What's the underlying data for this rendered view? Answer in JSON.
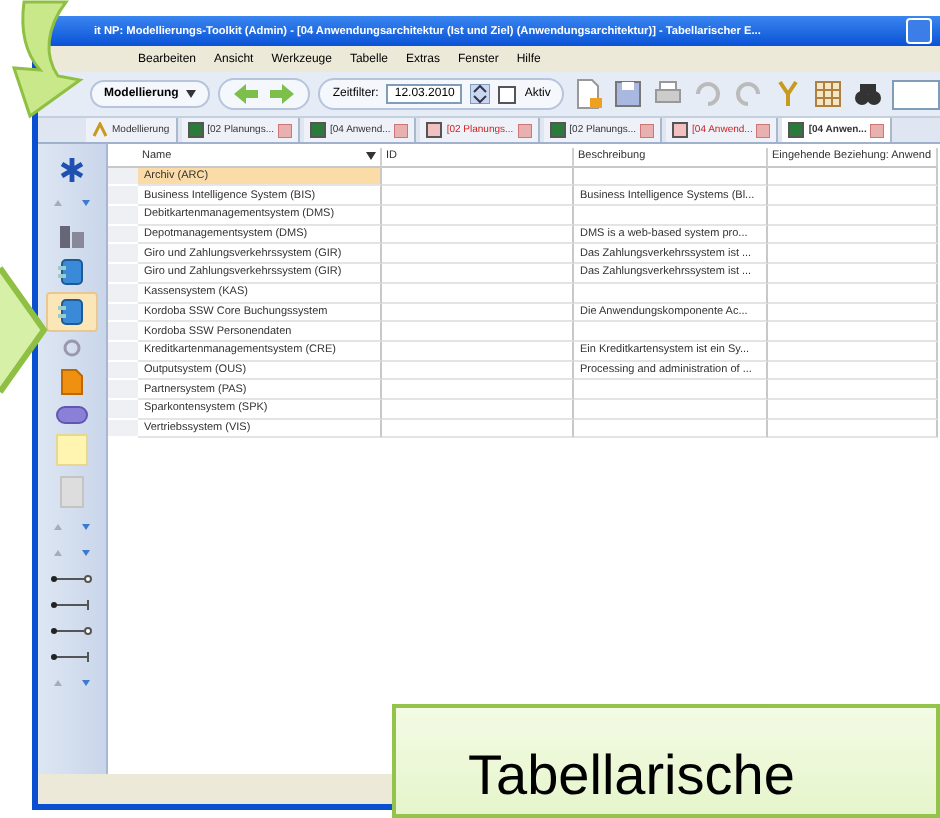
{
  "window": {
    "title": "it NP: Modellierungs-Toolkit (Admin) - [04 Anwendungsarchitektur (Ist und Ziel) (Anwendungsarchitektur)] - Tabellarischer E..."
  },
  "menu": [
    "Bearbeiten",
    "Ansicht",
    "Werkzeuge",
    "Tabelle",
    "Extras",
    "Fenster",
    "Hilfe"
  ],
  "toolbar": {
    "perspective": "Modellierung",
    "time_filter_label": "Zeitfilter:",
    "date": "12.03.2010",
    "active_label": "Aktiv",
    "active_checked": false
  },
  "tabs": [
    {
      "label": "Modellierung",
      "selected": false,
      "flagged": false
    },
    {
      "label": "[02 Planungs...",
      "selected": false,
      "flagged": false
    },
    {
      "label": "[04 Anwend...",
      "selected": false,
      "flagged": false
    },
    {
      "label": "[02 Planungs...",
      "selected": false,
      "flagged": true
    },
    {
      "label": "[02 Planungs...",
      "selected": false,
      "flagged": false
    },
    {
      "label": "[04 Anwend...",
      "selected": false,
      "flagged": true
    },
    {
      "label": "[04 Anwen...",
      "selected": true,
      "flagged": false
    }
  ],
  "palette": [
    {
      "kind": "asterisk",
      "selected": false
    },
    {
      "kind": "nav",
      "selected": false
    },
    {
      "kind": "building",
      "selected": false
    },
    {
      "kind": "component",
      "selected": false
    },
    {
      "kind": "component",
      "selected": true
    },
    {
      "kind": "interface",
      "selected": false
    },
    {
      "kind": "document",
      "selected": false
    },
    {
      "kind": "pill",
      "selected": false
    },
    {
      "kind": "note",
      "selected": false
    },
    {
      "kind": "frame",
      "selected": false
    },
    {
      "kind": "nav",
      "selected": false
    },
    {
      "kind": "nav",
      "selected": false
    },
    {
      "kind": "link-open",
      "selected": false
    },
    {
      "kind": "link-bar",
      "selected": false
    },
    {
      "kind": "link-open",
      "selected": false
    },
    {
      "kind": "link-bar",
      "selected": false
    },
    {
      "kind": "nav",
      "selected": false
    }
  ],
  "table": {
    "columns": [
      "Name",
      "ID",
      "Beschreibung",
      "Eingehende Beziehung: Anwend"
    ],
    "rows": [
      {
        "name": "Archiv (ARC)",
        "selected": true
      },
      {
        "name": "Business Intelligence System (BIS)",
        "description": "Business Intelligence Systems (Bl...",
        "selected": false
      },
      {
        "name": "Debitkartenmanagementsystem (DMS)",
        "selected": false
      },
      {
        "name": "Depotmanagementsystem (DMS)",
        "description": "DMS is a web-based system pro...",
        "selected": false
      },
      {
        "name": "Giro und Zahlungsverkehrssystem (GIR)",
        "description": "Das Zahlungsverkehrssystem ist ...",
        "selected": false
      },
      {
        "name": "Giro und Zahlungsverkehrssystem (GIR)",
        "description": "Das Zahlungsverkehrssystem ist ...",
        "selected": false
      },
      {
        "name": "Kassensystem (KAS)",
        "selected": false
      },
      {
        "name": "Kordoba SSW Core Buchungssystem",
        "description": "Die Anwendungskomponente Ac...",
        "selected": false
      },
      {
        "name": "Kordoba SSW Personendaten",
        "selected": false
      },
      {
        "name": "Kreditkartenmanagementsystem (CRE)",
        "description": "Ein Kreditkartensystem ist ein Sy...",
        "selected": false
      },
      {
        "name": "Outputsystem (OUS)",
        "description": "Processing and administration of ...",
        "selected": false
      },
      {
        "name": "Partnersystem (PAS)",
        "selected": false
      },
      {
        "name": "Sparkontensystem (SPK)",
        "selected": false
      },
      {
        "name": "Vertriebssystem (VIS)",
        "selected": false
      }
    ]
  },
  "callout": {
    "text": "Tabellarische"
  }
}
